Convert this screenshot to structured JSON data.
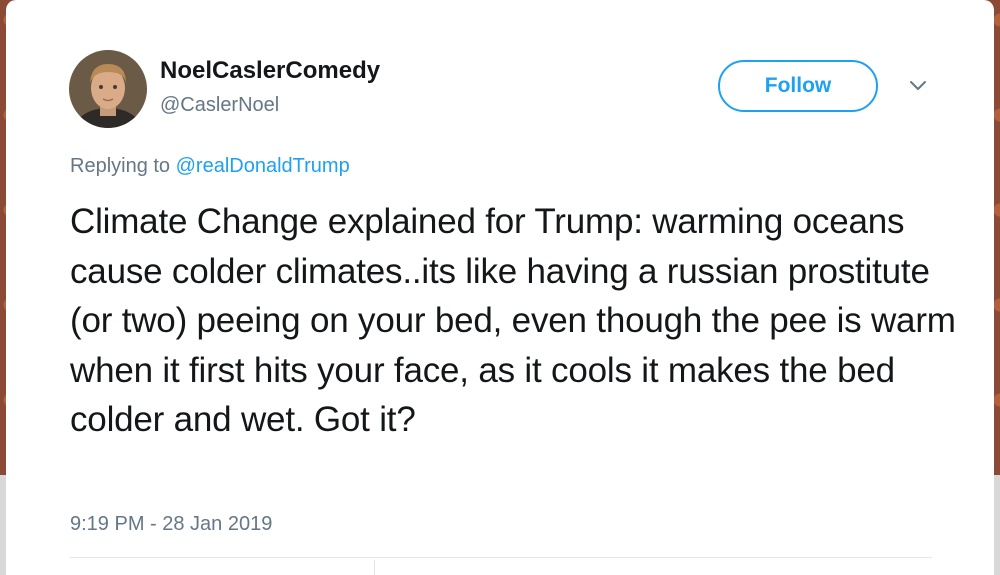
{
  "tweet": {
    "display_name": "NoelCaslerComedy",
    "handle": "@CaslerNoel",
    "follow_label": "Follow",
    "reply_prefix": "Replying to ",
    "reply_to": "@realDonaldTrump",
    "text": "Climate Change explained for Trump: warming oceans cause colder climates..its like having a russian prostitute (or two) peeing on your bed, even though the pee is warm when it first hits your face, as it cools it makes the bed colder and wet. Got it?",
    "timestamp": "9:19 PM - 28 Jan 2019"
  },
  "colors": {
    "accent": "#1da1f2",
    "secondary_text": "#657786",
    "primary_text": "#14171a"
  },
  "icons": {
    "avatar": "profile-photo",
    "menu": "chevron-down-icon"
  }
}
